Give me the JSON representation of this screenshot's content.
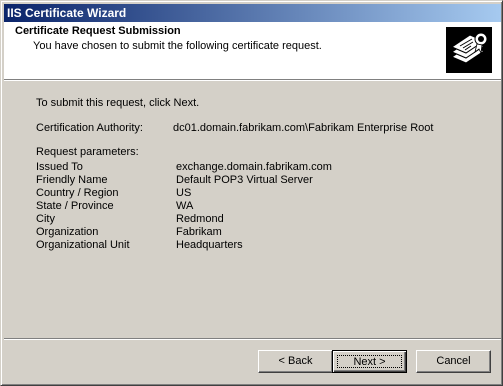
{
  "window": {
    "title": "IIS Certificate Wizard"
  },
  "header": {
    "title": "Certificate Request Submission",
    "subtitle": "You have chosen to submit the following certificate request.",
    "icon": "certificate-wizard-icon"
  },
  "body": {
    "instruction": "To submit this request, click Next.",
    "ca_label": "Certification Authority:",
    "ca_value": "dc01.domain.fabrikam.com\\Fabrikam Enterprise Root",
    "params_heading": "Request parameters:",
    "params": [
      {
        "label": "Issued To",
        "value": "exchange.domain.fabrikam.com"
      },
      {
        "label": "Friendly Name",
        "value": "Default POP3 Virtual Server"
      },
      {
        "label": "Country / Region",
        "value": "US"
      },
      {
        "label": "State / Province",
        "value": "WA"
      },
      {
        "label": "City",
        "value": "Redmond"
      },
      {
        "label": "Organization",
        "value": "Fabrikam"
      },
      {
        "label": "Organizational Unit",
        "value": "Headquarters"
      }
    ]
  },
  "buttons": {
    "back": "< Back",
    "next": "Next >",
    "cancel": "Cancel"
  },
  "colors": {
    "title_bar_start": "#0a246a",
    "title_bar_end": "#a6caf0",
    "dialog_face": "#d4d0c8"
  }
}
